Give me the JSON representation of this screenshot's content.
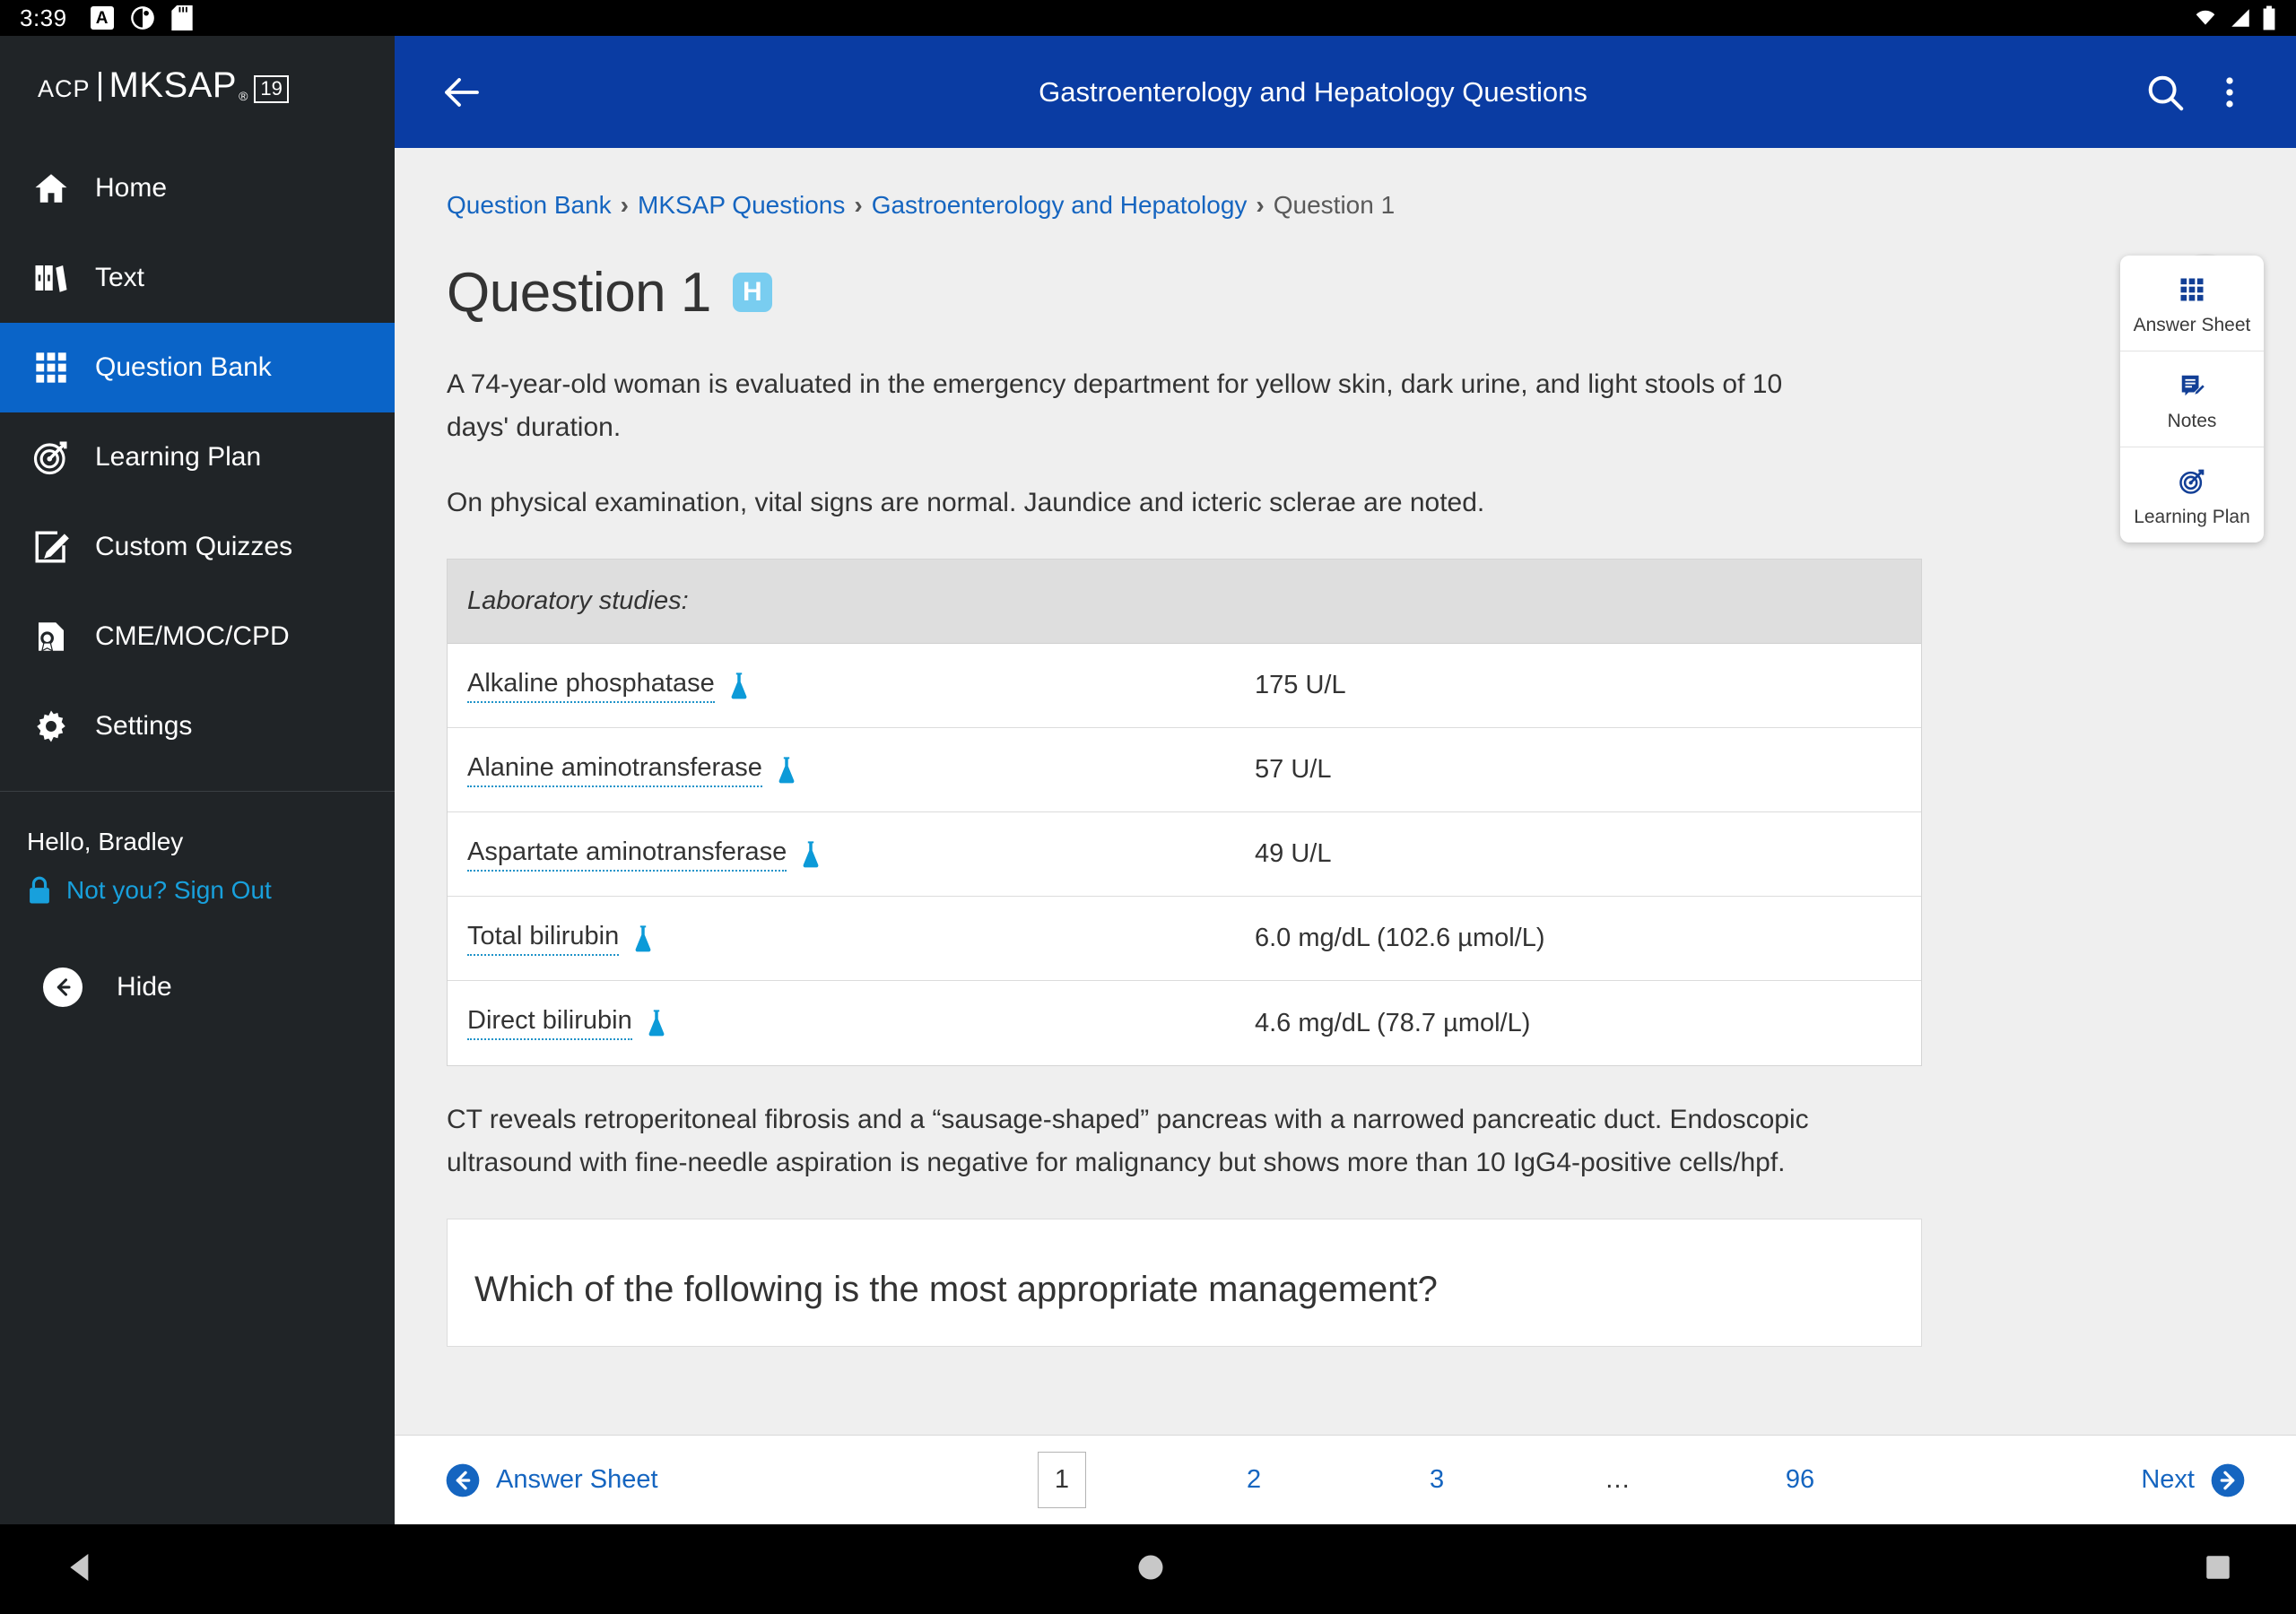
{
  "status_bar": {
    "time": "3:39",
    "icons": [
      "font-size-a-icon",
      "do-not-disturb-icon",
      "sd-card-icon"
    ],
    "right_icons": [
      "wifi-icon",
      "signal-icon",
      "battery-icon"
    ]
  },
  "sidebar": {
    "logo": {
      "acp": "ACP",
      "mksap": "MKSAP",
      "registered": "®",
      "edition": "19"
    },
    "items": [
      {
        "label": "Home",
        "icon": "home-icon",
        "active": false
      },
      {
        "label": "Text",
        "icon": "books-icon",
        "active": false
      },
      {
        "label": "Question Bank",
        "icon": "grid-icon",
        "active": true
      },
      {
        "label": "Learning Plan",
        "icon": "target-icon",
        "active": false
      },
      {
        "label": "Custom Quizzes",
        "icon": "edit-square-icon",
        "active": false
      },
      {
        "label": "CME/MOC/CPD",
        "icon": "certificate-icon",
        "active": false
      },
      {
        "label": "Settings",
        "icon": "gear-icon",
        "active": false
      }
    ],
    "greeting": "Hello, Bradley",
    "sign_out": "Not you? Sign Out",
    "hide": "Hide",
    "accent": "#0a64c8",
    "link_color": "#18a0dc"
  },
  "appbar": {
    "back_icon": "back-arrow-icon",
    "title": "Gastroenterology and Hepatology Questions",
    "search_icon": "search-icon",
    "overflow_icon": "more-vertical-icon",
    "background": "#0a3ca3"
  },
  "breadcrumb": {
    "items": [
      "Question Bank",
      "MKSAP Questions",
      "Gastroenterology and Hepatology"
    ],
    "current": "Question 1",
    "separator": "›"
  },
  "question": {
    "title": "Question 1",
    "badge": "H",
    "badge_color": "#79cdf0",
    "star_icon": "star-outline-icon",
    "paragraph1": "A 74-year-old woman is evaluated in the emergency department for yellow skin, dark urine, and light stools of 10 days' duration.",
    "paragraph2": "On physical examination, vital signs are normal. Jaundice and icteric sclerae are noted.",
    "paragraph3": "CT reveals retroperitoneal fibrosis and a “sausage-shaped” pancreas with a narrowed pancreatic duct. Endoscopic ultrasound with fine-needle aspiration is negative for malignancy but shows more than 10 IgG4-positive cells/hpf.",
    "prompt": "Which of the following is the most appropriate management?"
  },
  "lab_table": {
    "caption": "Laboratory studies:",
    "rows": [
      {
        "name": "Alkaline phosphatase",
        "value": "175 U/L"
      },
      {
        "name": "Alanine aminotransferase",
        "value": "57 U/L"
      },
      {
        "name": "Aspartate aminotransferase",
        "value": "49 U/L"
      },
      {
        "name": "Total bilirubin",
        "value": "6.0 mg/dL (102.6 µmol/L)"
      },
      {
        "name": "Direct bilirubin",
        "value": "4.6 mg/dL (78.7 µmol/L)"
      }
    ],
    "row_icon": "flask-icon"
  },
  "right_panel": {
    "items": [
      {
        "label": "Answer Sheet",
        "icon": "grid-icon"
      },
      {
        "label": "Notes",
        "icon": "note-edit-icon"
      },
      {
        "label": "Learning Plan",
        "icon": "target-icon"
      }
    ],
    "icon_color": "#123f96"
  },
  "pagination": {
    "answer_sheet": "Answer Sheet",
    "pages": [
      "1",
      "2",
      "3",
      "…",
      "96"
    ],
    "active_page": "1",
    "next": "Next",
    "link_color": "#1565c0"
  },
  "nav_bar": {
    "back": "triangle-back-icon",
    "home": "circle-home-icon",
    "recents": "square-recents-icon"
  }
}
